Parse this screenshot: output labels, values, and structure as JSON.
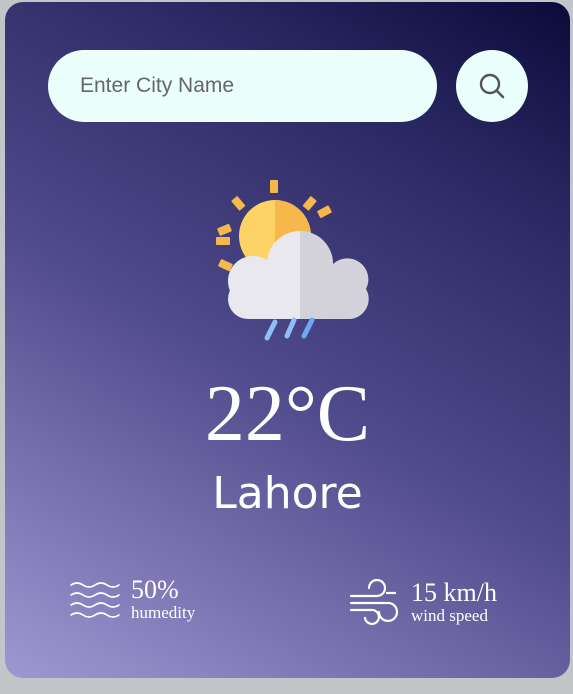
{
  "search": {
    "placeholder": "Enter City Name",
    "button_icon": "search-icon"
  },
  "weather": {
    "icon": "sun-cloud-rain-icon",
    "temperature": "22°C",
    "city": "Lahore"
  },
  "details": {
    "humidity": {
      "icon": "humidity-waves-icon",
      "value": "50%",
      "label": "humedity"
    },
    "wind": {
      "icon": "wind-icon",
      "value": "15 km/h",
      "label": "wind speed"
    }
  },
  "colors": {
    "input_background": "#ebfffc",
    "text": "#ffffff",
    "sun": "#fbc94a",
    "rain": "#6fa8f0"
  }
}
